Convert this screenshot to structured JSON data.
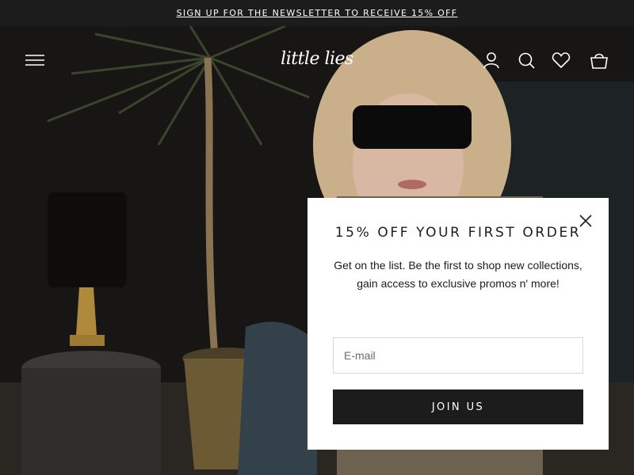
{
  "announcement": {
    "text": "SIGN UP FOR THE NEWSLETTER TO RECEIVE 15% OFF"
  },
  "header": {
    "logo_text": "little lies",
    "icons": [
      "menu-icon",
      "account-icon",
      "search-icon",
      "wishlist-icon",
      "cart-icon"
    ]
  },
  "popup": {
    "title": "15% OFF YOUR FIRST ORDER",
    "body": "Get on the list. Be the first to shop new collections, gain access to exclusive promos n' more!",
    "email_placeholder": "E-mail",
    "email_value": "",
    "submit_label": "JOIN US"
  },
  "colors": {
    "announcement_bg": "#1c1c1c",
    "popup_bg": "#ffffff",
    "button_bg": "#1c1c1c",
    "text": "#1c1c1c"
  }
}
